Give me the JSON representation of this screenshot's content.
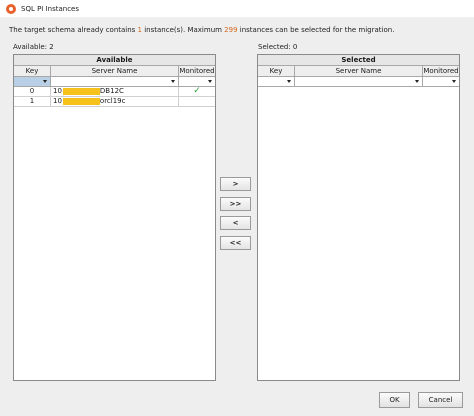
{
  "window": {
    "title": "SQL PI Instances",
    "accent": "#e8612c"
  },
  "info": {
    "prefix": "The target schema already contains ",
    "count": "1",
    "middle": " instance(s). Maximum ",
    "max": "299",
    "suffix": " instances can be selected for the migration."
  },
  "available": {
    "count_label": "Available: 2",
    "header": "Available",
    "columns": [
      "Key",
      "Server Name",
      "Monitored"
    ],
    "rows": [
      {
        "key": "0",
        "server_prefix": "10",
        "server_suffix": "DB12C",
        "monitored": true
      },
      {
        "key": "1",
        "server_prefix": "10",
        "server_suffix": "orcl19c",
        "monitored": false
      }
    ]
  },
  "selected": {
    "count_label": "Selected: 0",
    "header": "Selected",
    "columns": [
      "Key",
      "Server Name",
      "Monitored"
    ],
    "rows": []
  },
  "move_buttons": {
    "add": ">",
    "add_all": ">>",
    "remove": "<",
    "remove_all": "<<"
  },
  "footer": {
    "ok": "OK",
    "cancel": "Cancel"
  },
  "icons": {
    "app": "sql-pi-app-icon",
    "check": "check-icon",
    "redaction": "#f6c11b",
    "check_color": "#2f9e3a",
    "highlight_number_color": "#d2691e"
  }
}
